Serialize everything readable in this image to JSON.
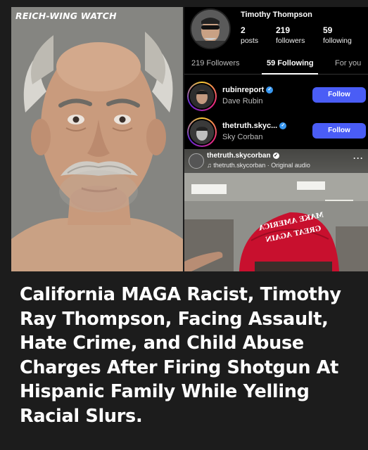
{
  "watermark": "REICH-WING WATCH",
  "profile": {
    "name": "Timothy Thompson",
    "stats": [
      {
        "value": "2",
        "label": "posts"
      },
      {
        "value": "219",
        "label": "followers"
      },
      {
        "value": "59",
        "label": "following"
      }
    ]
  },
  "tabs": [
    {
      "label": "219 Followers",
      "active": false
    },
    {
      "label": "59 Following",
      "active": true
    },
    {
      "label": "For you",
      "active": false
    }
  ],
  "accounts": [
    {
      "username": "rubinreport",
      "fullname": "Dave Rubin",
      "verified": true,
      "button": "Follow"
    },
    {
      "username": "thetruth.skyc...",
      "fullname": "Sky Corban",
      "verified": true,
      "button": "Follow"
    }
  ],
  "reel": {
    "username": "thetruth.skycorban",
    "audio": "♫ thetruth.skycorban · Original audio",
    "more": "···",
    "hat_text_top": "MAKE AMERICA",
    "hat_text_bottom": "GREAT AGAIN"
  },
  "headline": "California MAGA Racist, Timothy Ray Thompson, Facing Assault, Hate Crime, and Child Abuse Charges After Firing Shotgun At Hispanic Family While Yelling Racial Slurs.",
  "colors": {
    "background": "#1c1c1c",
    "follow_button": "#4a5df6",
    "verified_badge": "#3897f0",
    "hat_red": "#c8102e"
  }
}
